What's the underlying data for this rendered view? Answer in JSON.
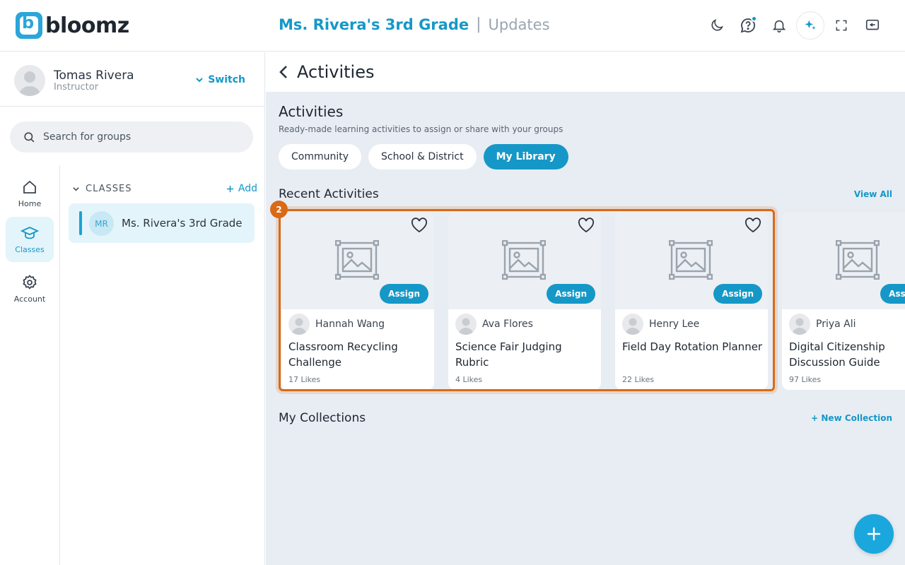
{
  "app": {
    "logo_text": "bloomz",
    "logo_letter": "b"
  },
  "header": {
    "class_name": "Ms. Rivera's 3rd Grade",
    "separator": "|",
    "section": "Updates"
  },
  "top_icons": [
    "moon-icon",
    "help-chat-icon",
    "bell-icon",
    "ai-sparkle-icon",
    "fullscreen-icon",
    "collapse-panel-icon"
  ],
  "user": {
    "name": "Tomas Rivera",
    "role": "Instructor",
    "switch_label": "Switch"
  },
  "search": {
    "placeholder": "Search for groups"
  },
  "rail": {
    "home": "Home",
    "classes": "Classes",
    "account": "Account"
  },
  "groups": {
    "section_label": "CLASSES",
    "add_label": "Add",
    "items": [
      {
        "initials": "MR",
        "name": "Ms. Rivera's 3rd Grade"
      }
    ]
  },
  "main": {
    "page_title": "Activities",
    "section_title": "Activities",
    "section_desc": "Ready-made learning activities to assign or share with your groups",
    "tabs": [
      "Community",
      "School & District",
      "My Library"
    ],
    "active_tab": "My Library",
    "recent_title": "Recent Activities",
    "view_all": "View All",
    "highlight_badge": "2",
    "cards": [
      {
        "author": "Hannah Wang",
        "title": "Classroom Recycling Challenge",
        "likes": "17 Likes",
        "assign": "Assign"
      },
      {
        "author": "Ava Flores",
        "title": "Science Fair Judging Rubric",
        "likes": "4 Likes",
        "assign": "Assign"
      },
      {
        "author": "Henry Lee",
        "title": "Field Day Rotation Planner",
        "likes": "22 Likes",
        "assign": "Assign"
      },
      {
        "author": "Priya Ali",
        "title": "Digital Citizenship Discussion Guide",
        "likes": "97 Likes",
        "assign": "Assign"
      }
    ],
    "collections_title": "My Collections",
    "new_collection": "+ New Collection"
  },
  "colors": {
    "accent": "#1598c7",
    "highlight": "#d96a16",
    "background": "#e8edf3"
  }
}
